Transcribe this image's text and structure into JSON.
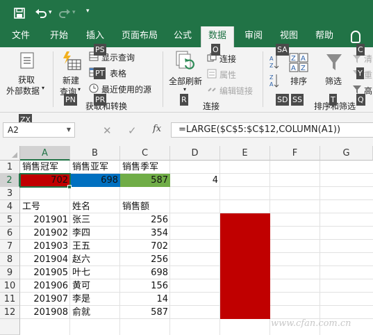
{
  "colors": {
    "brand": "#217346",
    "cell_a2_fill": "#c00000",
    "cell_b2_fill": "#0070c0",
    "cell_c2_fill": "#70ad47",
    "cell_e5_e12_fill": "#c00000"
  },
  "qat": {
    "save_icon": "save-icon",
    "undo_icon": "undo-icon",
    "redo_icon": "redo-icon",
    "customize_icon": "chevron-down-icon"
  },
  "tabs": [
    {
      "label": "文件"
    },
    {
      "label": "开始"
    },
    {
      "label": "插入"
    },
    {
      "label": "页面布局"
    },
    {
      "label": "公式"
    },
    {
      "label": "数据",
      "active": true
    },
    {
      "label": "审阅"
    },
    {
      "label": "视图"
    },
    {
      "label": "帮助"
    }
  ],
  "ribbon": {
    "get_external_data": "获取\n外部数据",
    "get_external_data_l1": "获取",
    "get_external_data_l2": "外部数据",
    "new_query_l1": "新建",
    "new_query_l2": "查询",
    "show_queries": "显示查询",
    "from_table": "表格",
    "recent_sources": "最近使用的源",
    "group_get_transform": "获取和转换",
    "refresh_all": "全部刷新",
    "connections": "连接",
    "properties": "属性",
    "edit_links": "编辑链接",
    "group_connections": "连接",
    "sort": "排序",
    "filter": "筛选",
    "clear": "清",
    "reapply": "重",
    "advanced": "高",
    "group_sort_filter": "排序和筛选",
    "keytips": {
      "ps": "PS",
      "pt": "PT",
      "pn": "PN",
      "pr": "PR",
      "o": "O",
      "r": "R",
      "sa": "SA",
      "sd": "SD",
      "ss": "SS",
      "t": "T",
      "c": "C",
      "y": "Y",
      "q": "Q",
      "zx": "ZX"
    }
  },
  "formula_bar": {
    "name_box": "A2",
    "cancel": "✕",
    "enter": "✓",
    "fx": "fx",
    "formula": "=LARGE($C$5:$C$12,COLUMN(A1))"
  },
  "columns": [
    "A",
    "B",
    "C",
    "D",
    "E",
    "F",
    "G"
  ],
  "rows": [
    "1",
    "2",
    "3",
    "4",
    "5",
    "6",
    "7",
    "8",
    "9",
    "10",
    "11",
    "12"
  ],
  "sheet": {
    "r1": [
      "销售冠军",
      "销售亚军",
      "销售季军"
    ],
    "r2": [
      "702",
      "698",
      "587",
      "4"
    ],
    "r4": [
      "工号",
      "姓名",
      "销售额"
    ],
    "records": [
      {
        "id": "201901",
        "name": "张三",
        "sales": "256"
      },
      {
        "id": "201902",
        "name": "李四",
        "sales": "354"
      },
      {
        "id": "201903",
        "name": "王五",
        "sales": "702"
      },
      {
        "id": "201904",
        "name": "赵六",
        "sales": "256"
      },
      {
        "id": "201905",
        "name": "叶七",
        "sales": "698"
      },
      {
        "id": "201906",
        "name": "黄可",
        "sales": "156"
      },
      {
        "id": "201907",
        "name": "李是",
        "sales": "14"
      },
      {
        "id": "201908",
        "name": "俞就",
        "sales": "587"
      }
    ]
  },
  "watermark": "www.cfan.com.cn"
}
